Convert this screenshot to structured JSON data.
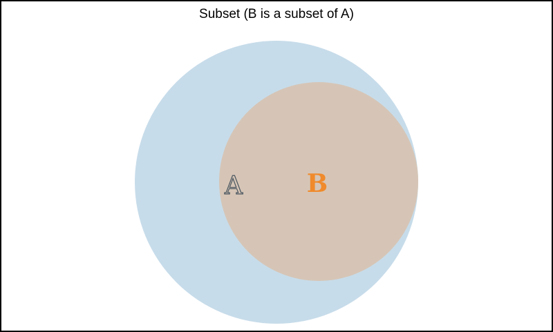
{
  "title": "Subset (B is a subset of A)",
  "sets": [
    {
      "id": "A",
      "label": "A",
      "fill": "#c7dcea",
      "label_color": "#4a5660"
    },
    {
      "id": "B",
      "label": "B",
      "fill": "#d6c5b6",
      "label_color": "#f08a2c"
    }
  ],
  "relation": "B is a subset of A",
  "colors": {
    "background": "#ffffff",
    "border": "#000000"
  }
}
